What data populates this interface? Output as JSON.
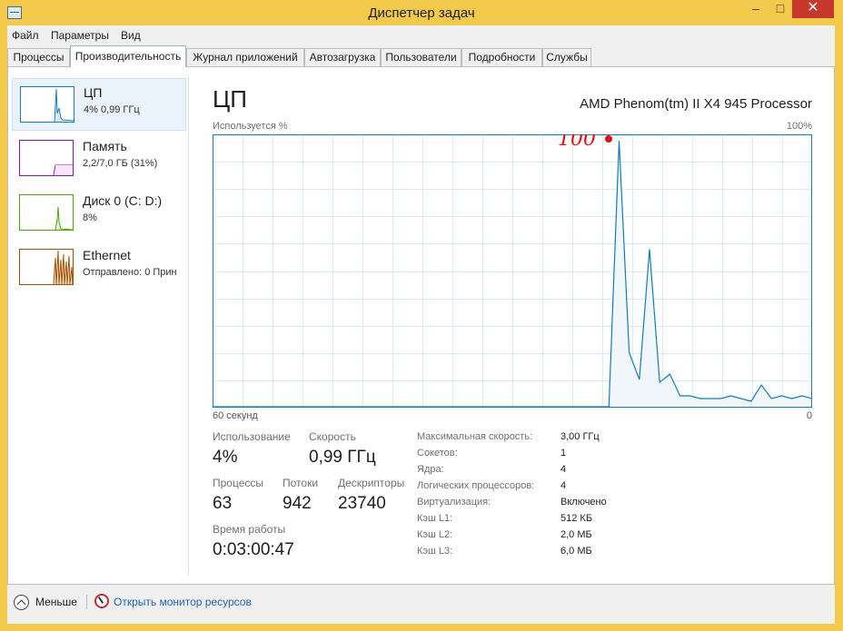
{
  "window": {
    "title": "Диспетчер задач",
    "minimize": "–",
    "maximize": "□",
    "close": "✕",
    "app_icon": "task-manager-icon"
  },
  "menu": [
    "Файл",
    "Параметры",
    "Вид"
  ],
  "tabs": [
    "Процессы",
    "Производительность",
    "Журнал приложений",
    "Автозагрузка",
    "Пользователи",
    "Подробности",
    "Службы"
  ],
  "active_tab": "Производительность",
  "sidebar": [
    {
      "title": "ЦП",
      "subtitle": "4% 0,99 ГГц",
      "color": "#117dbb",
      "selected": true
    },
    {
      "title": "Память",
      "subtitle": "2,2/7,0 ГБ (31%)",
      "color": "#8b12ae"
    },
    {
      "title": "Диск 0 (C: D:)",
      "subtitle": "8%",
      "color": "#4da60c"
    },
    {
      "title": "Ethernet",
      "subtitle": "Отправлено: 0 Прин",
      "color": "#a74f01"
    }
  ],
  "cpu": {
    "title": "ЦП",
    "model": "AMD Phenom(tm) II X4 945 Processor",
    "graph_label": "Используется %",
    "graph_max": "100%",
    "axis_left": "60 секунд",
    "axis_right": "0",
    "annotation_text": "100",
    "annotation_color": "#e01010",
    "line_color": "#117dbb",
    "fill_color": "#f1f6fa",
    "grid_color": "#d9eaf4",
    "usage_series": [
      0,
      0,
      0,
      0,
      0,
      0,
      0,
      0,
      0,
      0,
      0,
      0,
      0,
      0,
      0,
      0,
      0,
      0,
      0,
      0,
      0,
      0,
      0,
      0,
      0,
      0,
      0,
      0,
      0,
      0,
      0,
      0,
      0,
      0,
      0,
      0,
      0,
      0,
      0,
      0,
      98,
      20,
      10,
      58,
      9,
      12,
      4,
      4,
      3,
      3,
      3,
      4,
      3,
      2,
      8,
      3,
      4,
      3,
      4,
      3
    ],
    "stats": {
      "usage_label": "Использование",
      "usage_value": "4%",
      "speed_label": "Скорость",
      "speed_value": "0,99 ГГц",
      "processes_label": "Процессы",
      "processes_value": "63",
      "threads_label": "Потоки",
      "threads_value": "942",
      "handles_label": "Дескрипторы",
      "handles_value": "23740",
      "uptime_label": "Время работы",
      "uptime_value": "0:03:00:47"
    },
    "info": [
      {
        "key": "Максимальная скорость:",
        "value": "3,00 ГГц"
      },
      {
        "key": "Сокетов:",
        "value": "1"
      },
      {
        "key": "Ядра:",
        "value": "4"
      },
      {
        "key": "Логических процессоров:",
        "value": "4"
      },
      {
        "key": "Виртуализация:",
        "value": "Включено"
      },
      {
        "key": "Кэш L1:",
        "value": "512 КБ"
      },
      {
        "key": "Кэш L2:",
        "value": "2,0 МБ"
      },
      {
        "key": "Кэш L3:",
        "value": "6,0 МБ"
      }
    ]
  },
  "footer": {
    "less": "Меньше",
    "monitor_link": "Открыть монитор ресурсов",
    "less_icon": "chevron-up-circle-icon",
    "monitor_icon": "resource-monitor-icon"
  }
}
